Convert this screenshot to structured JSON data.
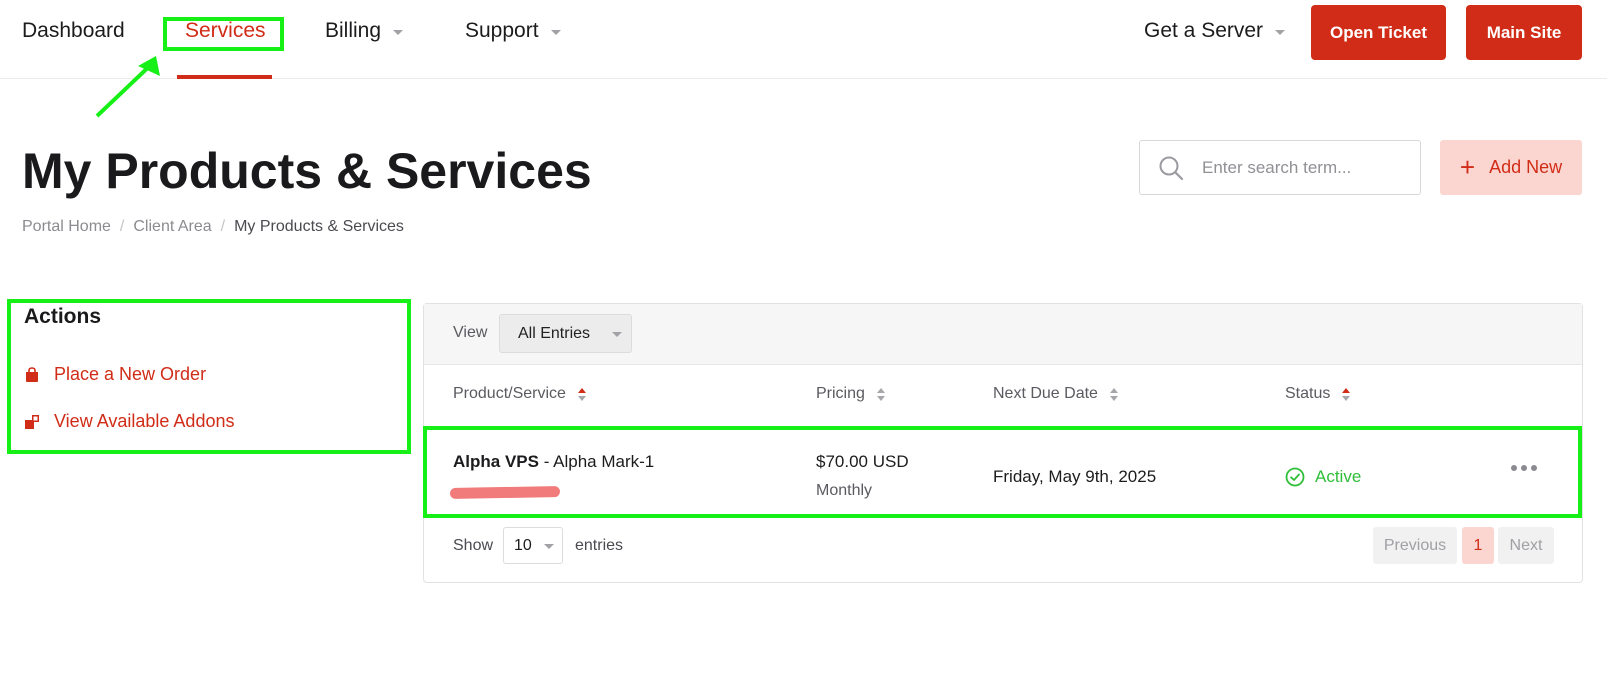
{
  "nav": {
    "items": [
      {
        "label": "Dashboard"
      },
      {
        "label": "Services"
      },
      {
        "label": "Billing"
      },
      {
        "label": "Support"
      }
    ],
    "get_server": "Get a Server",
    "open_ticket": "Open Ticket",
    "main_site": "Main Site"
  },
  "page": {
    "title": "My Products & Services",
    "breadcrumb": [
      "Portal Home",
      "Client Area",
      "My Products & Services"
    ]
  },
  "search": {
    "placeholder": "Enter search term..."
  },
  "add_new": {
    "label": "Add New",
    "icon": "plus-icon"
  },
  "actions": {
    "title": "Actions",
    "items": [
      {
        "label": "Place a New Order",
        "icon": "shopping-bag-icon"
      },
      {
        "label": "View Available Addons",
        "icon": "addons-icon"
      }
    ]
  },
  "table": {
    "view_label": "View",
    "view_selected": "All Entries",
    "headers": [
      "Product/Service",
      "Pricing",
      "Next Due Date",
      "Status"
    ],
    "rows": [
      {
        "product": "Alpha VPS",
        "product_suffix": "- Alpha Mark-1",
        "price": "$70.00 USD",
        "cycle": "Monthly",
        "due": "Friday, May 9th, 2025",
        "status": "Active"
      }
    ],
    "show_label": "Show",
    "page_size": "10",
    "entries_label": "entries",
    "pagination": {
      "prev": "Previous",
      "current": "1",
      "next": "Next"
    }
  },
  "colors": {
    "accent": "#d12c17",
    "accent_light": "#fbd6d0",
    "status_active": "#2fbe3a",
    "annotation": "#17f017"
  }
}
